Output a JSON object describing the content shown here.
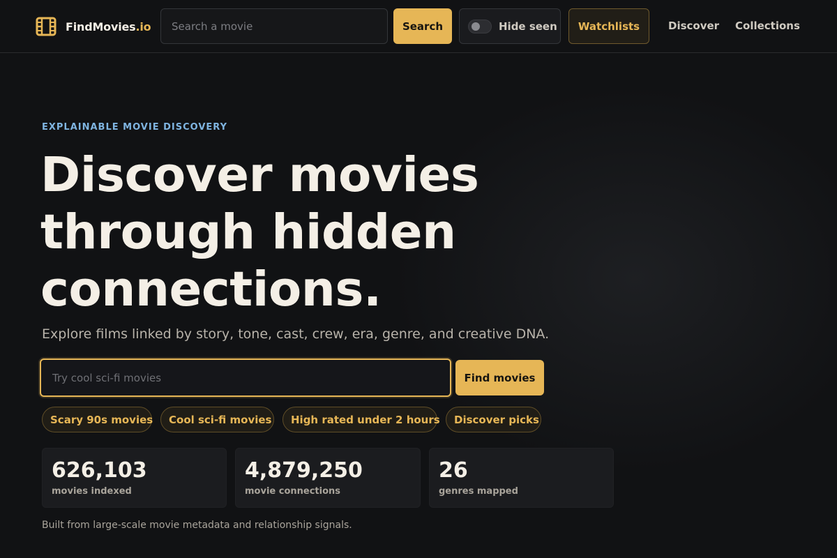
{
  "header": {
    "logo_name": "FindMovies",
    "logo_tld": ".io",
    "search_placeholder": "Search a movie",
    "search_label": "Search",
    "hide_seen_label": "Hide seen",
    "hide_seen_on": false,
    "watchlists_label": "Watchlists",
    "nav": [
      {
        "label": "Discover"
      },
      {
        "label": "Collections"
      }
    ]
  },
  "hero": {
    "eyebrow": "EXPLAINABLE MOVIE DISCOVERY",
    "headline_lines": [
      "Discover movies",
      "through hidden",
      "connections."
    ],
    "subhead": "Explore films linked by story, tone, cast, crew, era, genre, and creative DNA.",
    "query_placeholder": "Try cool sci-fi movies",
    "find_label": "Find movies",
    "chips": [
      {
        "label": "Scary 90s movies"
      },
      {
        "label": "Cool sci-fi movies"
      },
      {
        "label": "High rated under 2 hours"
      },
      {
        "label": "Discover picks"
      }
    ],
    "stats": [
      {
        "value": "626,103",
        "label": "movies indexed"
      },
      {
        "value": "4,879,250",
        "label": "movie connections"
      },
      {
        "value": "26",
        "label": "genres mapped"
      }
    ],
    "footnote": "Built from large-scale movie metadata and relationship signals."
  },
  "icons": {
    "logo": "film-strip-icon"
  },
  "colors": {
    "accent": "#e6b656",
    "eyebrow": "#7fb4e0",
    "background": "#111214"
  }
}
